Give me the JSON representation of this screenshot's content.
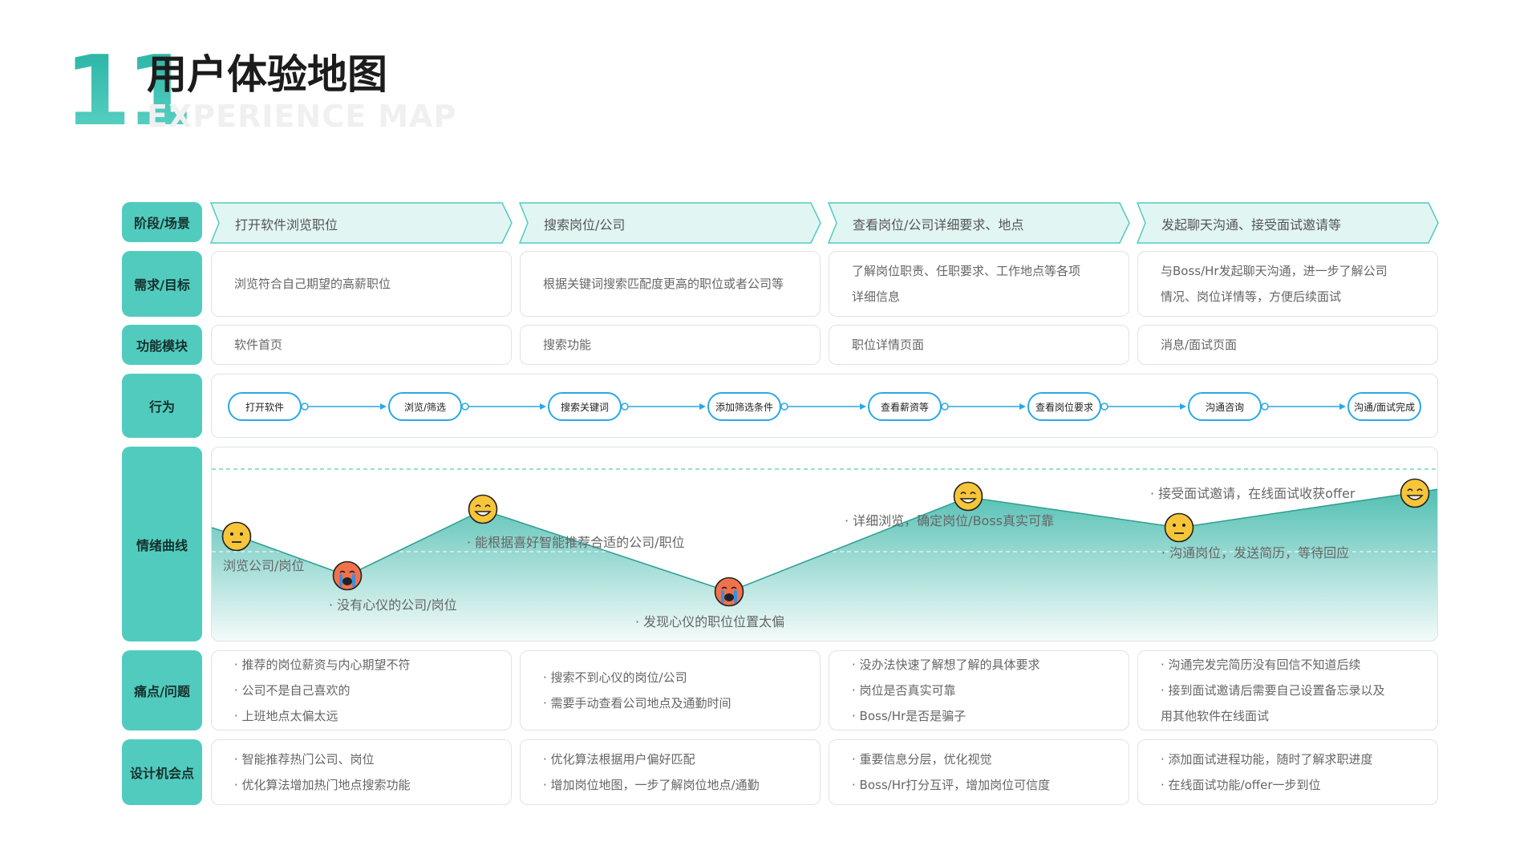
{
  "header": {
    "number": "11",
    "title": "用户体验地图",
    "subtitle": "EXPERIENCE MAP"
  },
  "rows": {
    "stage": {
      "label": "阶段/场景",
      "cells": [
        "打开软件浏览职位",
        "搜索岗位/公司",
        "查看岗位/公司详细要求、地点",
        "发起聊天沟通、接受面试邀请等"
      ]
    },
    "needs": {
      "label": "需求/目标",
      "cells": [
        [
          "浏览符合自己期望的高薪职位"
        ],
        [
          "根据关键词搜索匹配度更高的职位或者公司等"
        ],
        [
          "了解岗位职责、任职要求、工作地点等各项",
          "详细信息"
        ],
        [
          "与Boss/Hr发起聊天沟通，进一步了解公司",
          "情况、岗位详情等，方便后续面试"
        ]
      ]
    },
    "modules": {
      "label": "功能模块",
      "cells": [
        "软件首页",
        "搜索功能",
        "职位详情页面",
        "消息/面试页面"
      ]
    },
    "behavior": {
      "label": "行为",
      "steps": [
        "打开软件",
        "浏览/筛选",
        "搜索关键词",
        "添加筛选条件",
        "查看薪资等",
        "查看岗位要求",
        "沟通咨询",
        "沟通/面试完成"
      ]
    },
    "emotion": {
      "label": "情绪曲线",
      "annotations": [
        "浏览公司/岗位",
        "· 没有心仪的公司/岗位",
        "· 能根据喜好智能推荐合适的公司/职位",
        "· 发现心仪的职位位置太偏",
        "· 详细浏览，确定岗位/Boss真实可靠",
        "· 沟通岗位，发送简历，等待回应",
        "· 接受面试邀请，在线面试收获offer"
      ],
      "faces": [
        "neutral",
        "crying",
        "happy",
        "crying",
        "happy",
        "neutral",
        "happy"
      ]
    },
    "pain": {
      "label": "痛点/问题",
      "cells": [
        [
          "· 推荐的岗位薪资与内心期望不符",
          "· 公司不是自己喜欢的",
          "· 上班地点太偏太远"
        ],
        [
          "· 搜索不到心仪的岗位/公司",
          "· 需要手动查看公司地点及通勤时间"
        ],
        [
          "· 没办法快速了解想了解的具体要求",
          "· 岗位是否真实可靠",
          "· Boss/Hr是否是骗子"
        ],
        [
          "· 沟通完发完简历没有回信不知道后续",
          "· 接到面试邀请后需要自己设置备忘录以及",
          "用其他软件在线面试"
        ]
      ]
    },
    "opportunity": {
      "label": "设计机会点",
      "cells": [
        [
          "· 智能推荐热门公司、岗位",
          "· 优化算法增加热门地点搜索功能"
        ],
        [
          "· 优化算法根据用户偏好匹配",
          "· 增加岗位地图，一步了解岗位地点/通勤"
        ],
        [
          "· 重要信息分层，优化视觉",
          "· Boss/Hr打分互评，增加岗位可信度"
        ],
        [
          "· 添加面试进程功能，随时了解求职进度",
          "· 在线面试功能/offer一步到位"
        ]
      ]
    }
  },
  "colors": {
    "accent": "#52cbbf",
    "arrow": "#29a8e6",
    "curve": "#3fb8aa",
    "face": "#f7c53a",
    "sad_face": "#f0724d"
  }
}
